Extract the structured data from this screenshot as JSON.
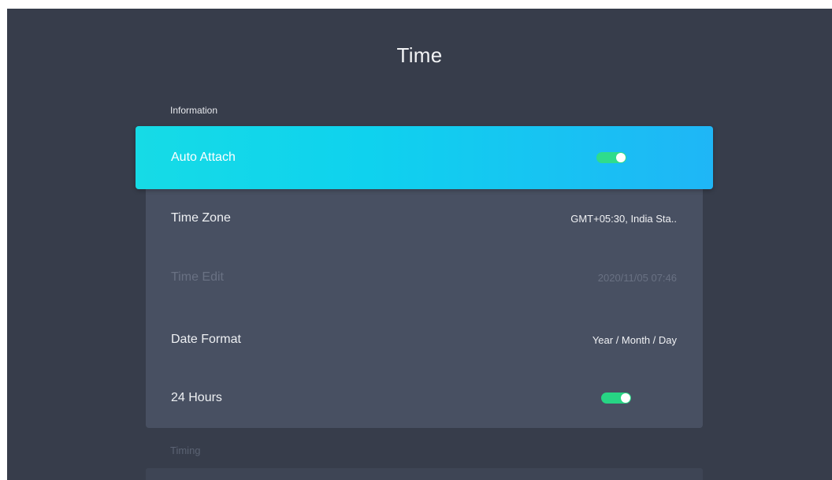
{
  "page": {
    "title": "Time"
  },
  "sections": {
    "information_label": "Information",
    "next_label": "Timing"
  },
  "rows": [
    {
      "label": "Auto Attach",
      "type": "toggle",
      "on": true,
      "focused": true
    },
    {
      "label": "Time Zone",
      "type": "value",
      "value": "GMT+05:30, India Sta.."
    },
    {
      "label": "Time Edit",
      "type": "value",
      "value": "2020/11/05 07:46",
      "disabled": true
    },
    {
      "label": "Date Format",
      "type": "value",
      "value": "Year / Month / Day"
    },
    {
      "label": "24 Hours",
      "type": "toggle",
      "on": true
    }
  ],
  "colors": {
    "background": "#373d4b",
    "panel": "#485062",
    "focus_gradient_start": "#16dbe6",
    "focus_gradient_end": "#1fb6f6",
    "toggle_on": "#27d584"
  }
}
